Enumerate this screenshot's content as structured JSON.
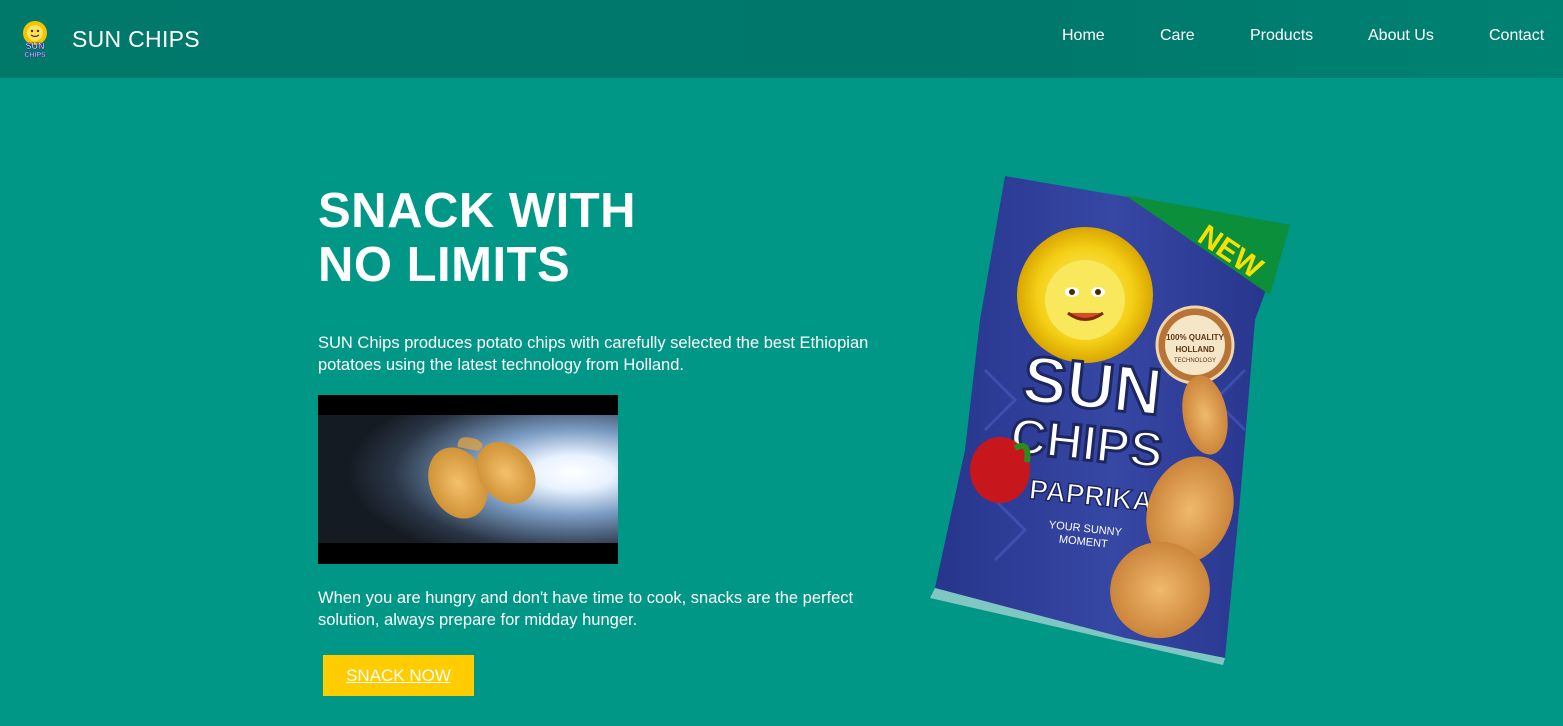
{
  "header": {
    "brand_name": "SUN CHIPS",
    "logo_text_top": "SUN",
    "logo_text_bottom": "CHIPS"
  },
  "nav": {
    "items": [
      {
        "label": "Home"
      },
      {
        "label": "Care"
      },
      {
        "label": "Products"
      },
      {
        "label": "About Us"
      },
      {
        "label": "Contact"
      }
    ]
  },
  "hero": {
    "title_line1": "SNACK WITH",
    "title_line2": "NO LIMITS",
    "description": "SUN Chips produces potato chips with carefully selected the best Ethiopian potatoes using the latest technology from Holland.",
    "note": "When you are hungry and don't have time to cook, snacks are the perfect solution, always prepare for midday hunger.",
    "cta_label": "SNACK NOW"
  },
  "product_bag": {
    "badge": "NEW",
    "brand_line1": "SUN",
    "brand_line2": "CHIPS",
    "flavor": "PAPRIKA",
    "tagline_line1": "YOUR SUNNY",
    "tagline_line2": "MOMENT",
    "seal_line1": "100% QUALITY",
    "seal_line2": "HOLLAND",
    "seal_line3": "TECHNOLOGY"
  },
  "colors": {
    "page_background": "#009787",
    "navbar_background": "#00796b",
    "cta_background": "#ffcc00",
    "bag_background": "#2b3a8f",
    "badge_background": "#0b8f3a",
    "badge_text": "#f7e100"
  }
}
